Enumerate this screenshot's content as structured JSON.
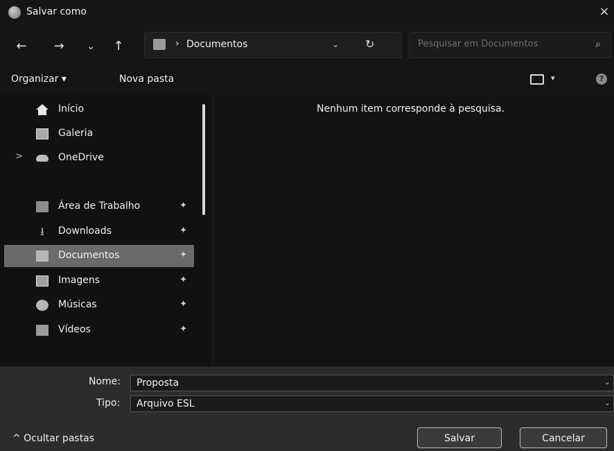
{
  "window": {
    "title": "Salvar como",
    "close_symbol": "×"
  },
  "nav": {
    "back_symbol": "←",
    "forward_symbol": "→",
    "history_symbol": "⌄",
    "up_symbol": "↑",
    "breadcrumb_separator": "›",
    "current_folder": "Documentos",
    "address_dropdown_symbol": "⌄",
    "refresh_symbol": "↻",
    "search_placeholder": "Pesquisar em Documentos",
    "search_symbol": "⌕"
  },
  "toolbar": {
    "organize_label": "Organizar ▾",
    "new_folder_label": "Nova pasta",
    "view_caret": "▾",
    "help_symbol": "?"
  },
  "sidebar": {
    "items": [
      {
        "label": "Início",
        "icon": "home-icon"
      },
      {
        "label": "Galeria",
        "icon": "gallery-icon"
      },
      {
        "label": "OneDrive",
        "icon": "cloud-icon",
        "expand_symbol": ">"
      },
      {
        "label": "Área de Trabalho",
        "icon": "desktop-icon",
        "pinned": true
      },
      {
        "label": "Downloads",
        "icon": "download-icon",
        "glyph": "⭳",
        "pinned": true
      },
      {
        "label": "Documentos",
        "icon": "documents-icon",
        "pinned": true,
        "selected": true
      },
      {
        "label": "Imagens",
        "icon": "images-icon",
        "pinned": true
      },
      {
        "label": "Músicas",
        "icon": "music-icon",
        "pinned": true
      },
      {
        "label": "Vídeos",
        "icon": "video-icon",
        "pinned": true
      }
    ],
    "pin_symbol": "✦"
  },
  "main": {
    "empty_message": "Nenhum item corresponde à pesquisa."
  },
  "form": {
    "name_label": "Nome:",
    "name_value": "Proposta",
    "type_label": "Tipo:",
    "type_value": "Arquivo ESL",
    "dropdown_symbol": "⌄",
    "hide_folders_label": "^ Ocultar pastas",
    "save_label": "Salvar",
    "cancel_label": "Cancelar"
  },
  "colors": {
    "background": "#111111",
    "selected_item": "#6a6a6a",
    "form_area": "#2c2c2c"
  }
}
